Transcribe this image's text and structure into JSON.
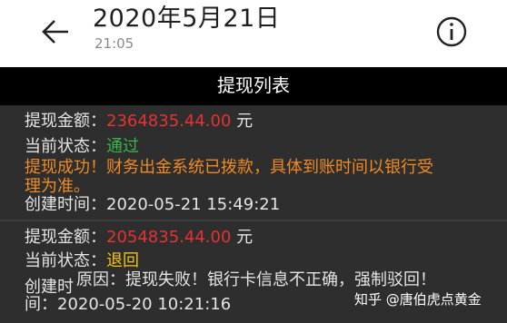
{
  "header": {
    "date_title": "2020年5月21日",
    "time": "21:05",
    "back_icon": "arrow-left-icon",
    "info_icon": "info-circle-icon"
  },
  "page": {
    "title": "提现列表"
  },
  "records": [
    {
      "amount_label": "提现金额：",
      "amount": "2364835.44.00",
      "amount_unit": "元",
      "status_label": "当前状态：",
      "status": "通过",
      "message_line1": "提现成功！财务出金系统已拨款，具体到账时间以银行受",
      "message_line2": "理为准。",
      "created_label": "创建时间：",
      "created_at": "2020-05-21 15:49:21"
    },
    {
      "amount_label": "提现金额：",
      "amount": "2054835.44.00",
      "amount_unit": "元",
      "status_label": "当前状态：",
      "status": "退回",
      "created_label_part1": "创建时",
      "reason": "原因：提现失败！银行卡信息不正确，强制驳回！",
      "created_label_part2": "间：",
      "created_at": "2020-05-20 10:21:16"
    }
  ],
  "watermark": {
    "text": "知乎 @唐伯虎点黄金"
  },
  "colors": {
    "amount": "#e53232",
    "status_pass": "#39b54a",
    "status_returned": "#f0c419",
    "success_message": "#f08a24"
  }
}
